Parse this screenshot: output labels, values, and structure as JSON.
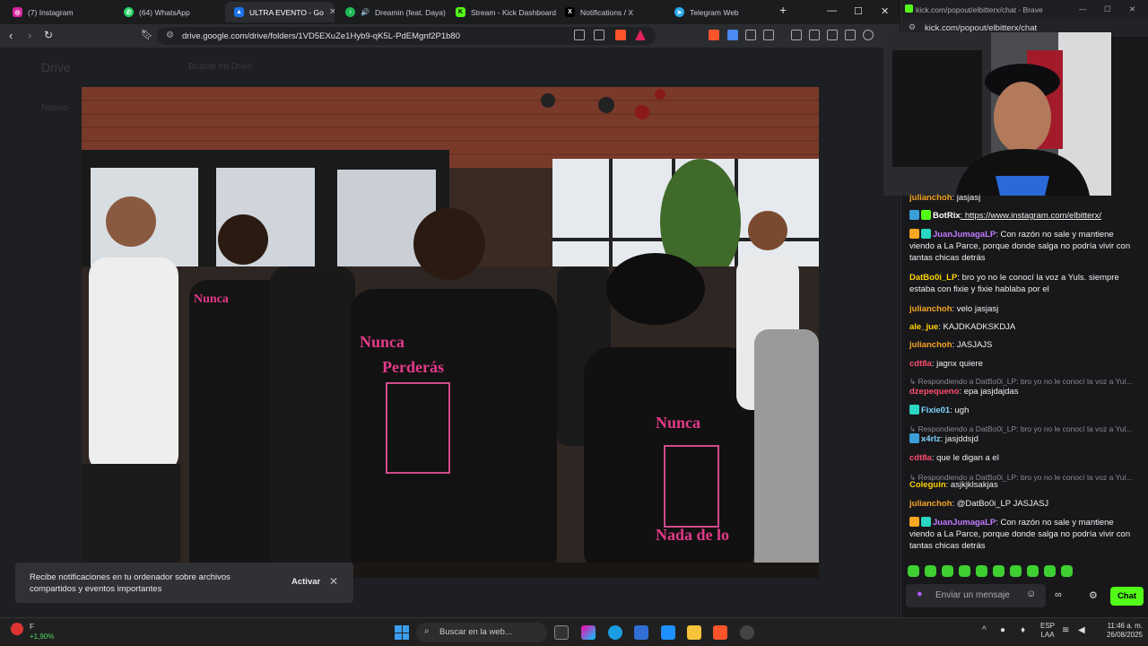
{
  "tabs": [
    {
      "label": "(7) Instagram",
      "color": "#d6249f",
      "glyph": "◎"
    },
    {
      "label": "(64) WhatsApp",
      "color": "#25d366",
      "glyph": "✆"
    },
    {
      "label": "ULTRA EVENTO - Go",
      "color": "#1a73e8",
      "glyph": "▲"
    },
    {
      "label": "Dreamin (feat. Daya)",
      "color": "#1db954",
      "glyph": "♪"
    },
    {
      "label": "Stream - Kick Dashboard",
      "color": "#53fc18",
      "glyph": "K"
    },
    {
      "label": "Notifications / X",
      "color": "#000000",
      "glyph": "𝕏"
    },
    {
      "label": "Telegram Web",
      "color": "#2aabee",
      "glyph": "➤"
    }
  ],
  "address": {
    "url": "drive.google.com/drive/folders/1VD5EXuZe1Hyb9-qK5L-PdEMgnf2P1b80"
  },
  "drive": {
    "logo": "Drive",
    "search_placeholder": "Buscar en Drive",
    "new_label": "Nuevo"
  },
  "toast": {
    "text": "Recibe notificaciones en tu ordenador sobre archivos compartidos y eventos importantes",
    "action": "Activar"
  },
  "chat_window": {
    "title": "kick.com/popout/elbitterx/chat - Brave",
    "url": "kick.com/popout/elbitterx/chat",
    "input_placeholder": "Enviar un mensaje",
    "send_label": "Chat",
    "messages": [
      {
        "type": "msg",
        "user": "julianchoh",
        "color": "#f5a623",
        "text": "jasjasj"
      },
      {
        "type": "msg",
        "user": "BotRix",
        "color": "#ffffff",
        "text": "https://www.instagram.com/elbitterx/",
        "badges": [
          "#3a9fd8",
          "#53fc18"
        ]
      },
      {
        "type": "msg",
        "user": "JuanJumagaLP",
        "color": "#c17bff",
        "text": "Con razón no sale y mantiene viendo a La Parce, porque donde salga no podría vivir con tantas chicas detrás",
        "badges": [
          "#f5a623",
          "#2bd6c2"
        ]
      },
      {
        "type": "msg",
        "user": "DatBo0i_LP",
        "color": "#ffd400",
        "text": "bro yo no le conocí la voz a Yuls. siempre estaba con fixie y fixie hablaba por el"
      },
      {
        "type": "msg",
        "user": "julianchoh",
        "color": "#f5a623",
        "text": "velo jasjasj"
      },
      {
        "type": "msg",
        "user": "ale_jue",
        "color": "#ffd400",
        "text": "KAJDKADKSKDJA"
      },
      {
        "type": "msg",
        "user": "julianchoh",
        "color": "#f5a623",
        "text": "JASJAJS"
      },
      {
        "type": "msg",
        "user": "cdt8a",
        "color": "#ff4d6d",
        "text": "jagnx quiere"
      },
      {
        "type": "reply",
        "text": "Respondiendo a DatBo0i_LP: bro yo no le conocí la voz a Yul..."
      },
      {
        "type": "msg",
        "user": "dzepequeno",
        "color": "#ff4d6d",
        "text": "epa jasjdajdas"
      },
      {
        "type": "msg",
        "user": "Fixie01",
        "color": "#7fd6ff",
        "text": "ugh",
        "badges": [
          "#2bd6c2"
        ]
      },
      {
        "type": "reply",
        "text": "Respondiendo a DatBo0i_LP: bro yo no le conocí la voz a Yul..."
      },
      {
        "type": "msg",
        "user": "x4rlz",
        "color": "#7fd6ff",
        "text": "jasjddsjd",
        "badges": [
          "#3a9fd8"
        ]
      },
      {
        "type": "msg",
        "user": "cdt8a",
        "color": "#ff4d6d",
        "text": "que le digan a el"
      },
      {
        "type": "reply",
        "text": "Respondiendo a DatBo0i_LP: bro yo no le conocí la voz a Yul..."
      },
      {
        "type": "msg",
        "user": "Coleguin",
        "color": "#ffd400",
        "text": "asjkjklsakjas"
      },
      {
        "type": "msg",
        "user": "julianchoh",
        "color": "#f5a623",
        "text": "@DatBo0i_LP JASJASJ"
      },
      {
        "type": "msg",
        "user": "JuanJumagaLP",
        "color": "#c17bff",
        "text": "Con razón no sale y mantiene viendo a La Parce, porque donde salga no podría vivir con tantas chicas detrás",
        "badges": [
          "#f5a623",
          "#2bd6c2"
        ]
      }
    ]
  },
  "taskbar": {
    "stock_label": "F",
    "stock_change": "+1,90%",
    "search_placeholder": "Buscar en la web...",
    "lang": "ESP",
    "lang_sub": "LAA",
    "time": "11:46 a. m.",
    "date": "26/08/2025"
  }
}
